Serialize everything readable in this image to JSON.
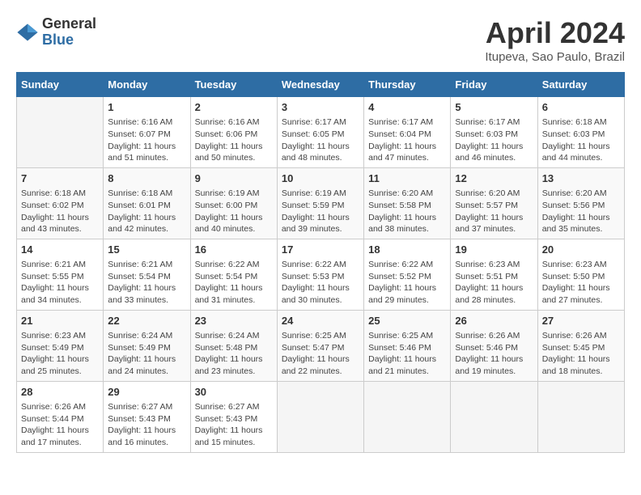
{
  "header": {
    "logo_general": "General",
    "logo_blue": "Blue",
    "month_title": "April 2024",
    "location": "Itupeva, Sao Paulo, Brazil"
  },
  "weekdays": [
    "Sunday",
    "Monday",
    "Tuesday",
    "Wednesday",
    "Thursday",
    "Friday",
    "Saturday"
  ],
  "weeks": [
    [
      {
        "day": "",
        "info": ""
      },
      {
        "day": "1",
        "info": "Sunrise: 6:16 AM\nSunset: 6:07 PM\nDaylight: 11 hours\nand 51 minutes."
      },
      {
        "day": "2",
        "info": "Sunrise: 6:16 AM\nSunset: 6:06 PM\nDaylight: 11 hours\nand 50 minutes."
      },
      {
        "day": "3",
        "info": "Sunrise: 6:17 AM\nSunset: 6:05 PM\nDaylight: 11 hours\nand 48 minutes."
      },
      {
        "day": "4",
        "info": "Sunrise: 6:17 AM\nSunset: 6:04 PM\nDaylight: 11 hours\nand 47 minutes."
      },
      {
        "day": "5",
        "info": "Sunrise: 6:17 AM\nSunset: 6:03 PM\nDaylight: 11 hours\nand 46 minutes."
      },
      {
        "day": "6",
        "info": "Sunrise: 6:18 AM\nSunset: 6:03 PM\nDaylight: 11 hours\nand 44 minutes."
      }
    ],
    [
      {
        "day": "7",
        "info": "Sunrise: 6:18 AM\nSunset: 6:02 PM\nDaylight: 11 hours\nand 43 minutes."
      },
      {
        "day": "8",
        "info": "Sunrise: 6:18 AM\nSunset: 6:01 PM\nDaylight: 11 hours\nand 42 minutes."
      },
      {
        "day": "9",
        "info": "Sunrise: 6:19 AM\nSunset: 6:00 PM\nDaylight: 11 hours\nand 40 minutes."
      },
      {
        "day": "10",
        "info": "Sunrise: 6:19 AM\nSunset: 5:59 PM\nDaylight: 11 hours\nand 39 minutes."
      },
      {
        "day": "11",
        "info": "Sunrise: 6:20 AM\nSunset: 5:58 PM\nDaylight: 11 hours\nand 38 minutes."
      },
      {
        "day": "12",
        "info": "Sunrise: 6:20 AM\nSunset: 5:57 PM\nDaylight: 11 hours\nand 37 minutes."
      },
      {
        "day": "13",
        "info": "Sunrise: 6:20 AM\nSunset: 5:56 PM\nDaylight: 11 hours\nand 35 minutes."
      }
    ],
    [
      {
        "day": "14",
        "info": "Sunrise: 6:21 AM\nSunset: 5:55 PM\nDaylight: 11 hours\nand 34 minutes."
      },
      {
        "day": "15",
        "info": "Sunrise: 6:21 AM\nSunset: 5:54 PM\nDaylight: 11 hours\nand 33 minutes."
      },
      {
        "day": "16",
        "info": "Sunrise: 6:22 AM\nSunset: 5:54 PM\nDaylight: 11 hours\nand 31 minutes."
      },
      {
        "day": "17",
        "info": "Sunrise: 6:22 AM\nSunset: 5:53 PM\nDaylight: 11 hours\nand 30 minutes."
      },
      {
        "day": "18",
        "info": "Sunrise: 6:22 AM\nSunset: 5:52 PM\nDaylight: 11 hours\nand 29 minutes."
      },
      {
        "day": "19",
        "info": "Sunrise: 6:23 AM\nSunset: 5:51 PM\nDaylight: 11 hours\nand 28 minutes."
      },
      {
        "day": "20",
        "info": "Sunrise: 6:23 AM\nSunset: 5:50 PM\nDaylight: 11 hours\nand 27 minutes."
      }
    ],
    [
      {
        "day": "21",
        "info": "Sunrise: 6:23 AM\nSunset: 5:49 PM\nDaylight: 11 hours\nand 25 minutes."
      },
      {
        "day": "22",
        "info": "Sunrise: 6:24 AM\nSunset: 5:49 PM\nDaylight: 11 hours\nand 24 minutes."
      },
      {
        "day": "23",
        "info": "Sunrise: 6:24 AM\nSunset: 5:48 PM\nDaylight: 11 hours\nand 23 minutes."
      },
      {
        "day": "24",
        "info": "Sunrise: 6:25 AM\nSunset: 5:47 PM\nDaylight: 11 hours\nand 22 minutes."
      },
      {
        "day": "25",
        "info": "Sunrise: 6:25 AM\nSunset: 5:46 PM\nDaylight: 11 hours\nand 21 minutes."
      },
      {
        "day": "26",
        "info": "Sunrise: 6:26 AM\nSunset: 5:46 PM\nDaylight: 11 hours\nand 19 minutes."
      },
      {
        "day": "27",
        "info": "Sunrise: 6:26 AM\nSunset: 5:45 PM\nDaylight: 11 hours\nand 18 minutes."
      }
    ],
    [
      {
        "day": "28",
        "info": "Sunrise: 6:26 AM\nSunset: 5:44 PM\nDaylight: 11 hours\nand 17 minutes."
      },
      {
        "day": "29",
        "info": "Sunrise: 6:27 AM\nSunset: 5:43 PM\nDaylight: 11 hours\nand 16 minutes."
      },
      {
        "day": "30",
        "info": "Sunrise: 6:27 AM\nSunset: 5:43 PM\nDaylight: 11 hours\nand 15 minutes."
      },
      {
        "day": "",
        "info": ""
      },
      {
        "day": "",
        "info": ""
      },
      {
        "day": "",
        "info": ""
      },
      {
        "day": "",
        "info": ""
      }
    ]
  ]
}
